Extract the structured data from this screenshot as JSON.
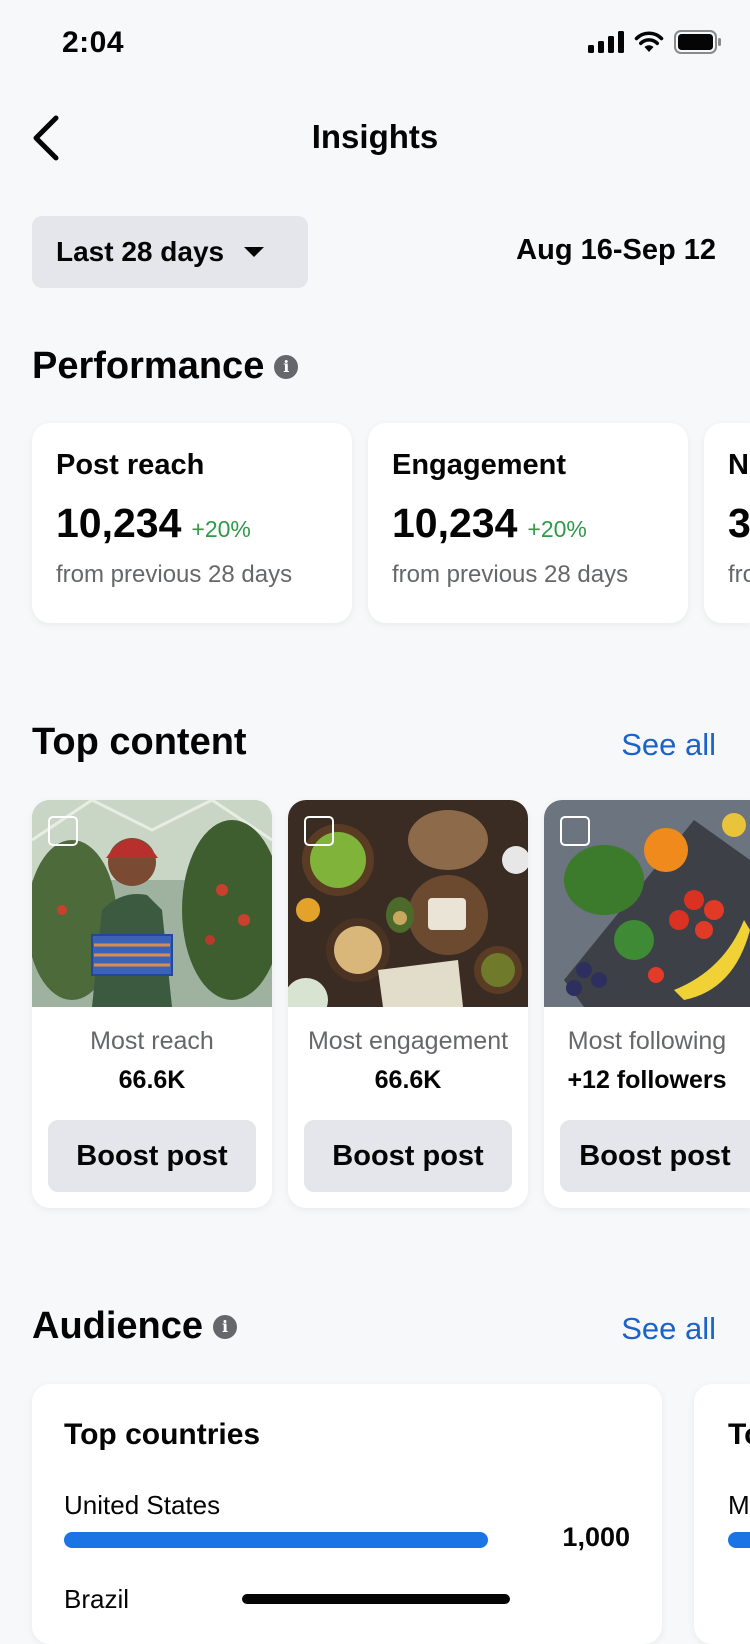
{
  "status": {
    "time": "2:04"
  },
  "header": {
    "title": "Insights"
  },
  "range": {
    "selected": "Last 28 days",
    "dates": "Aug 16-Sep 12"
  },
  "performance": {
    "title": "Performance",
    "cards": [
      {
        "title": "Post reach",
        "value": "10,234",
        "change": "+20%",
        "sub": "from previous 28 days"
      },
      {
        "title": "Engagement",
        "value": "10,234",
        "change": "+20%",
        "sub": "from previous 28 days"
      },
      {
        "title": "N",
        "value": "3",
        "change": "",
        "sub": "fro"
      }
    ]
  },
  "top_content": {
    "title": "Top content",
    "see_all": "See all",
    "items": [
      {
        "label": "Most reach",
        "value": "66.6K",
        "button": "Boost post"
      },
      {
        "label": "Most engagement",
        "value": "66.6K",
        "button": "Boost post"
      },
      {
        "label": "Most following",
        "value": "+12 followers",
        "button": "Boost post"
      }
    ]
  },
  "audience": {
    "title": "Audience",
    "see_all": "See all",
    "card_title": "Top countries",
    "card2_title": "To",
    "card2_row": "M",
    "countries": [
      {
        "name": "United States",
        "value": "1,000",
        "fraction": 1.0
      },
      {
        "name": "Brazil",
        "value": "",
        "fraction": 0
      }
    ]
  }
}
